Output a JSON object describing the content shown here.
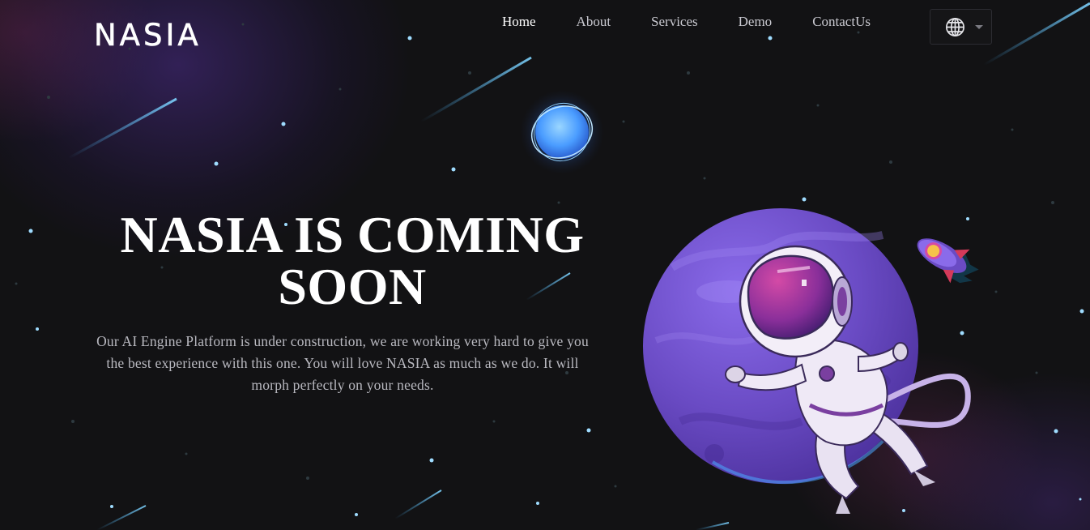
{
  "brand": {
    "logo_text": "NASIA"
  },
  "nav": {
    "items": [
      {
        "label": "Home",
        "active": true
      },
      {
        "label": "About",
        "active": false
      },
      {
        "label": "Services",
        "active": false
      },
      {
        "label": "Demo",
        "active": false
      },
      {
        "label": "ContactUs",
        "active": false
      }
    ],
    "language_icon": "globe-icon",
    "dropdown_icon": "caret-down-icon"
  },
  "hero": {
    "title_line1": "NASIA IS COMING",
    "title_line2": "SOON",
    "description": "Our AI Engine Platform is under construction, we are working very hard to give you the best experience with this one. You will love NASIA as much as we do. It will morph perfectly on your needs."
  },
  "colors": {
    "background": "#121214",
    "planet": "#6a4bc4",
    "accent_blue": "#4aa8ff",
    "text_muted": "#b9b9c0"
  }
}
